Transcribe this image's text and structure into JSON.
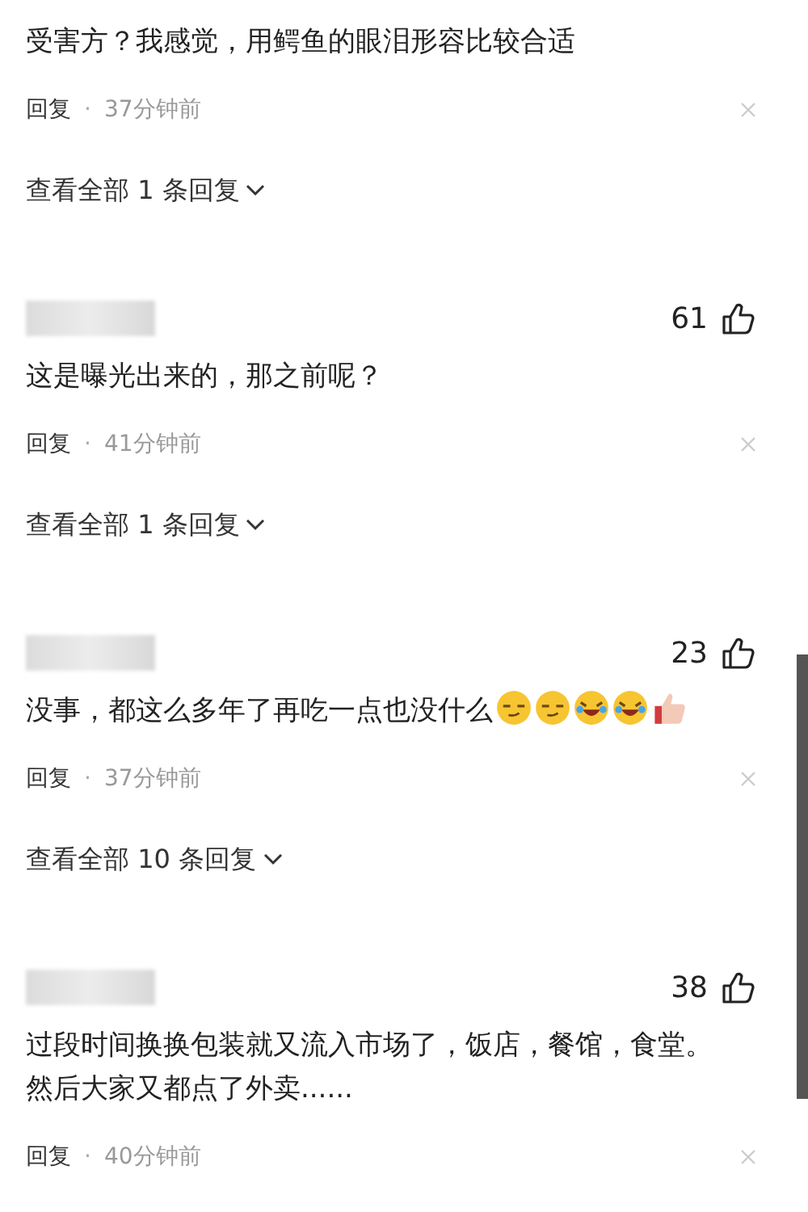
{
  "comments": [
    {
      "text": "受害方？我感觉，用鳄鱼的眼泪形容比较合适",
      "reply": "回复",
      "separator": "·",
      "time": "37分钟前",
      "expand": "查看全部 1 条回复"
    },
    {
      "username_hidden": true,
      "likes": "61",
      "text": "这是曝光出来的，那之前呢？",
      "reply": "回复",
      "separator": "·",
      "time": "41分钟前",
      "expand": "查看全部 1 条回复"
    },
    {
      "username_hidden": true,
      "likes": "23",
      "text": "没事，都这么多年了再吃一点也没什么",
      "stickers": [
        {
          "kind": "smirk"
        },
        {
          "kind": "smirk"
        },
        {
          "kind": "laugh"
        },
        {
          "kind": "laugh"
        },
        {
          "kind": "thumb"
        }
      ],
      "reply": "回复",
      "separator": "·",
      "time": "37分钟前",
      "expand": "查看全部 10 条回复"
    },
    {
      "username_hidden": true,
      "likes": "38",
      "text": "过段时间换换包装就又流入市场了，饭店，餐馆，食堂。然后大家又都点了外卖......",
      "reply": "回复",
      "separator": "·",
      "time": "40分钟前"
    }
  ]
}
